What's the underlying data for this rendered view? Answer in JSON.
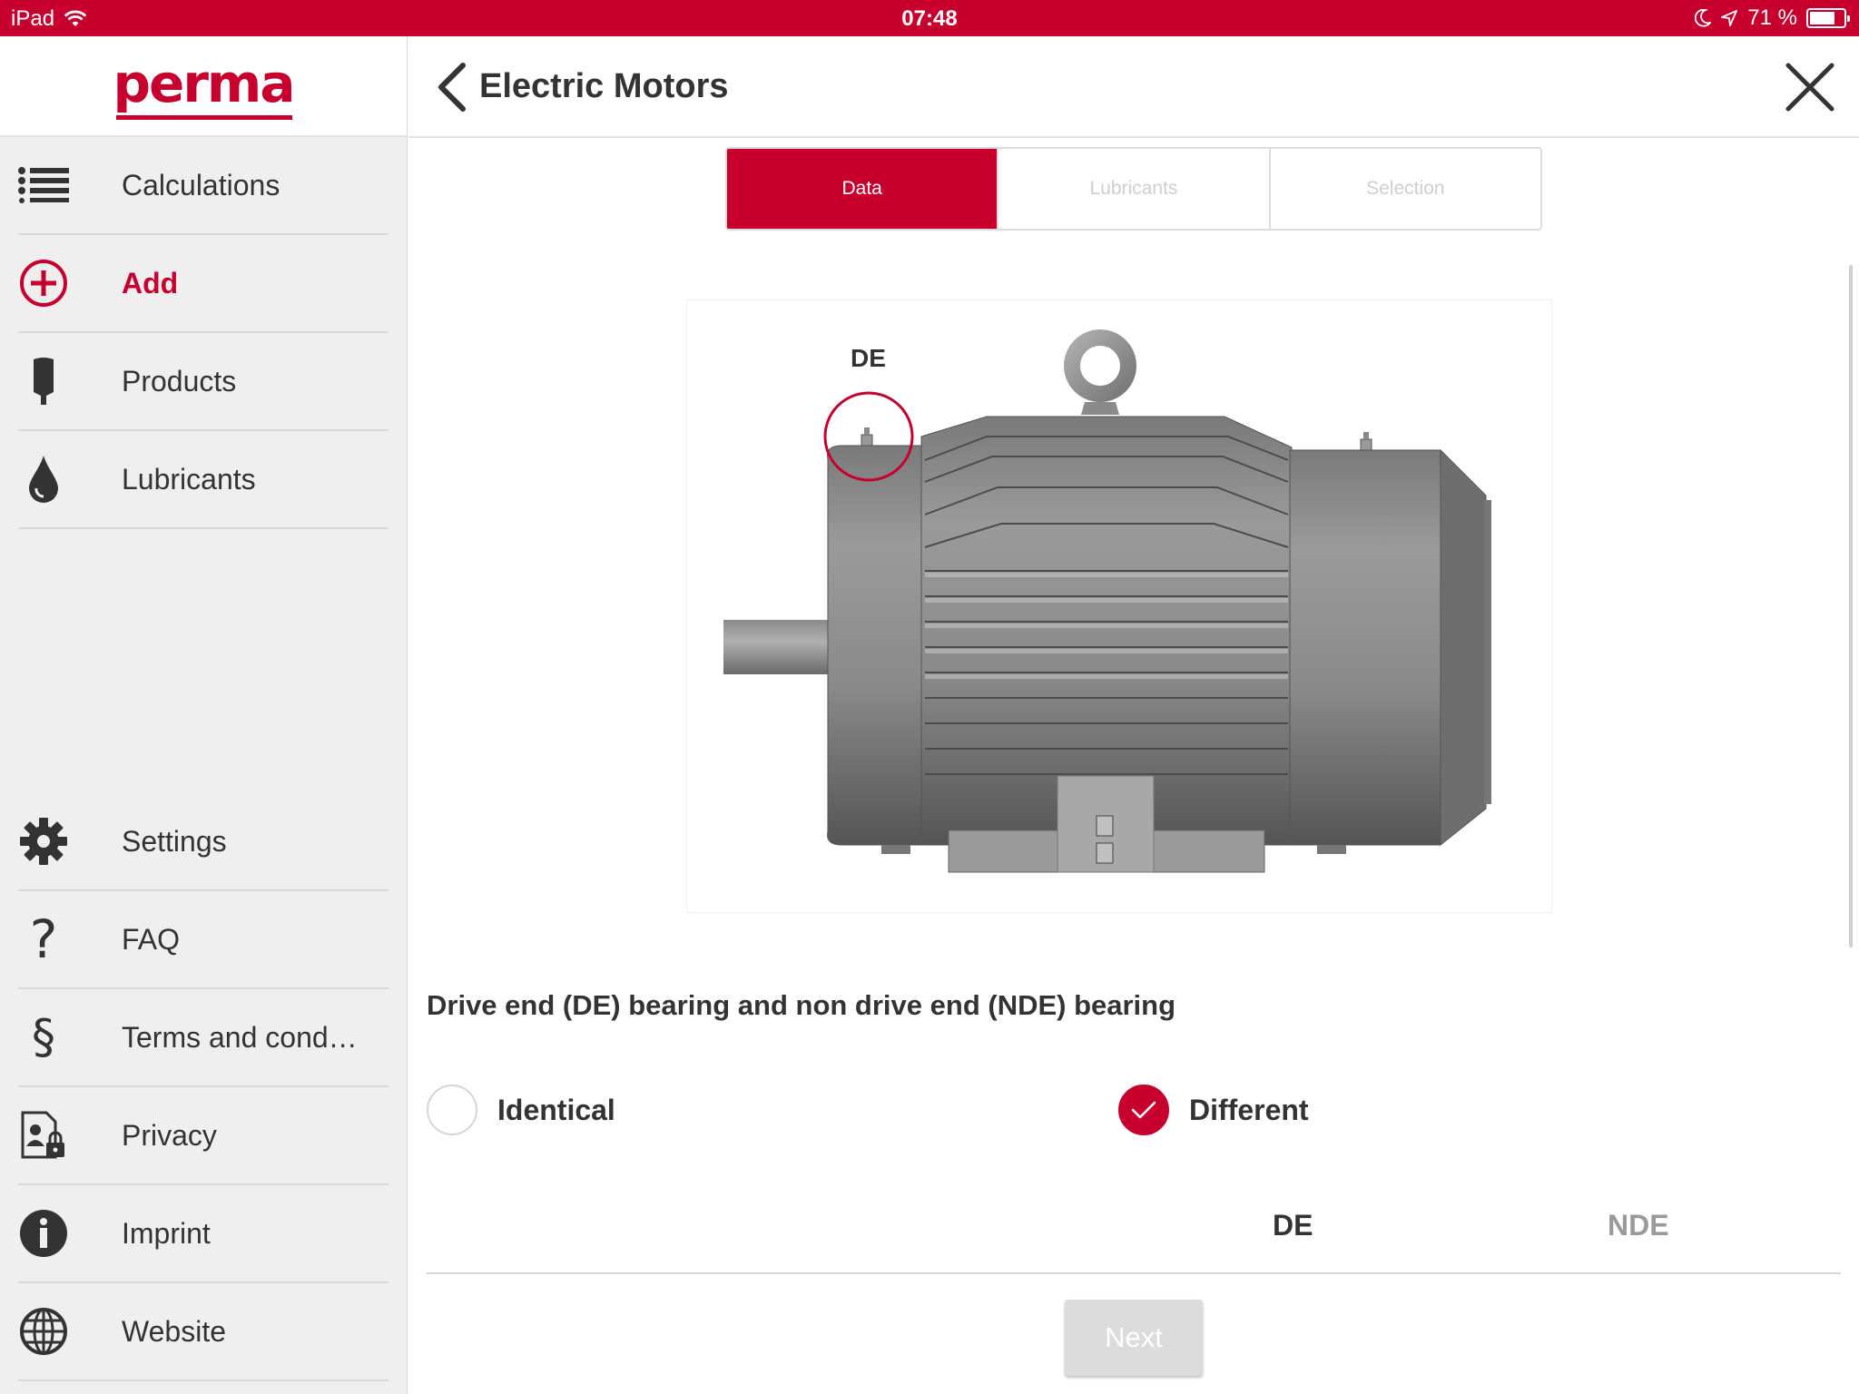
{
  "status_bar": {
    "device": "iPad",
    "time": "07:48",
    "battery": "71 %"
  },
  "brand": {
    "logo_text": "perma",
    "accent_color": "#c8002e"
  },
  "sidebar": {
    "top_items": [
      {
        "label": "Calculations",
        "icon": "list-icon"
      },
      {
        "label": "Add",
        "icon": "add-circle-icon",
        "active": true
      },
      {
        "label": "Products",
        "icon": "lubricator-icon"
      },
      {
        "label": "Lubricants",
        "icon": "drop-icon"
      }
    ],
    "bottom_items": [
      {
        "label": "Settings",
        "icon": "gear-icon"
      },
      {
        "label": "FAQ",
        "icon": "question-icon"
      },
      {
        "label": "Terms and cond…",
        "icon": "section-icon"
      },
      {
        "label": "Privacy",
        "icon": "privacy-document-icon"
      },
      {
        "label": "Imprint",
        "icon": "info-icon"
      },
      {
        "label": "Website",
        "icon": "globe-icon"
      }
    ]
  },
  "header": {
    "title": "Electric Motors"
  },
  "tabs": [
    {
      "label": "Data",
      "active": true
    },
    {
      "label": "Lubricants",
      "active": false
    },
    {
      "label": "Selection",
      "active": false
    }
  ],
  "image": {
    "marker_label": "DE"
  },
  "question": {
    "text": "Drive end (DE) bearing and non drive end (NDE) bearing",
    "options": [
      {
        "label": "Identical",
        "checked": false
      },
      {
        "label": "Different",
        "checked": true
      }
    ]
  },
  "bearings": {
    "de_label": "DE",
    "nde_label": "NDE"
  },
  "footer": {
    "next_label": "Next"
  }
}
